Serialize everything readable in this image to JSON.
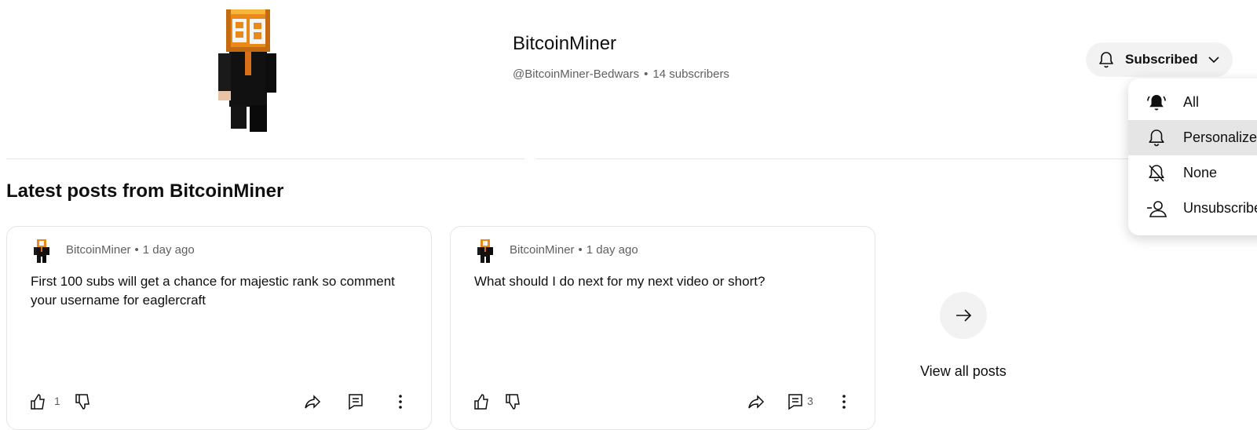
{
  "channel": {
    "name": "BitcoinMiner",
    "handle": "@BitcoinMiner-Bedwars",
    "separator": "•",
    "subscribers": "14 subscribers"
  },
  "subscribe_button": {
    "label": "Subscribed"
  },
  "notification_menu": {
    "items": [
      {
        "label": "All",
        "icon": "bell-filled-icon"
      },
      {
        "label": "Personalized",
        "icon": "bell-icon",
        "selected": true
      },
      {
        "label": "None",
        "icon": "bell-off-icon"
      },
      {
        "label": "Unsubscribe",
        "icon": "person-minus-icon"
      }
    ]
  },
  "posts_section": {
    "title": "Latest posts from BitcoinMiner",
    "view_all_label": "View all posts",
    "posts": [
      {
        "author": "BitcoinMiner",
        "separator": "•",
        "time": "1 day ago",
        "text": "First 100 subs will get a chance for majestic rank so comment your username for eaglercraft",
        "likes": "1"
      },
      {
        "author": "BitcoinMiner",
        "separator": "•",
        "time": "1 day ago",
        "text": "What should I do next for my next video or short?",
        "comments": "3"
      }
    ]
  },
  "colors": {
    "text_primary": "#0f0f0f",
    "text_secondary": "#606060",
    "chip_bg": "#f2f2f2",
    "bitcoin_orange": "#e8891a"
  }
}
